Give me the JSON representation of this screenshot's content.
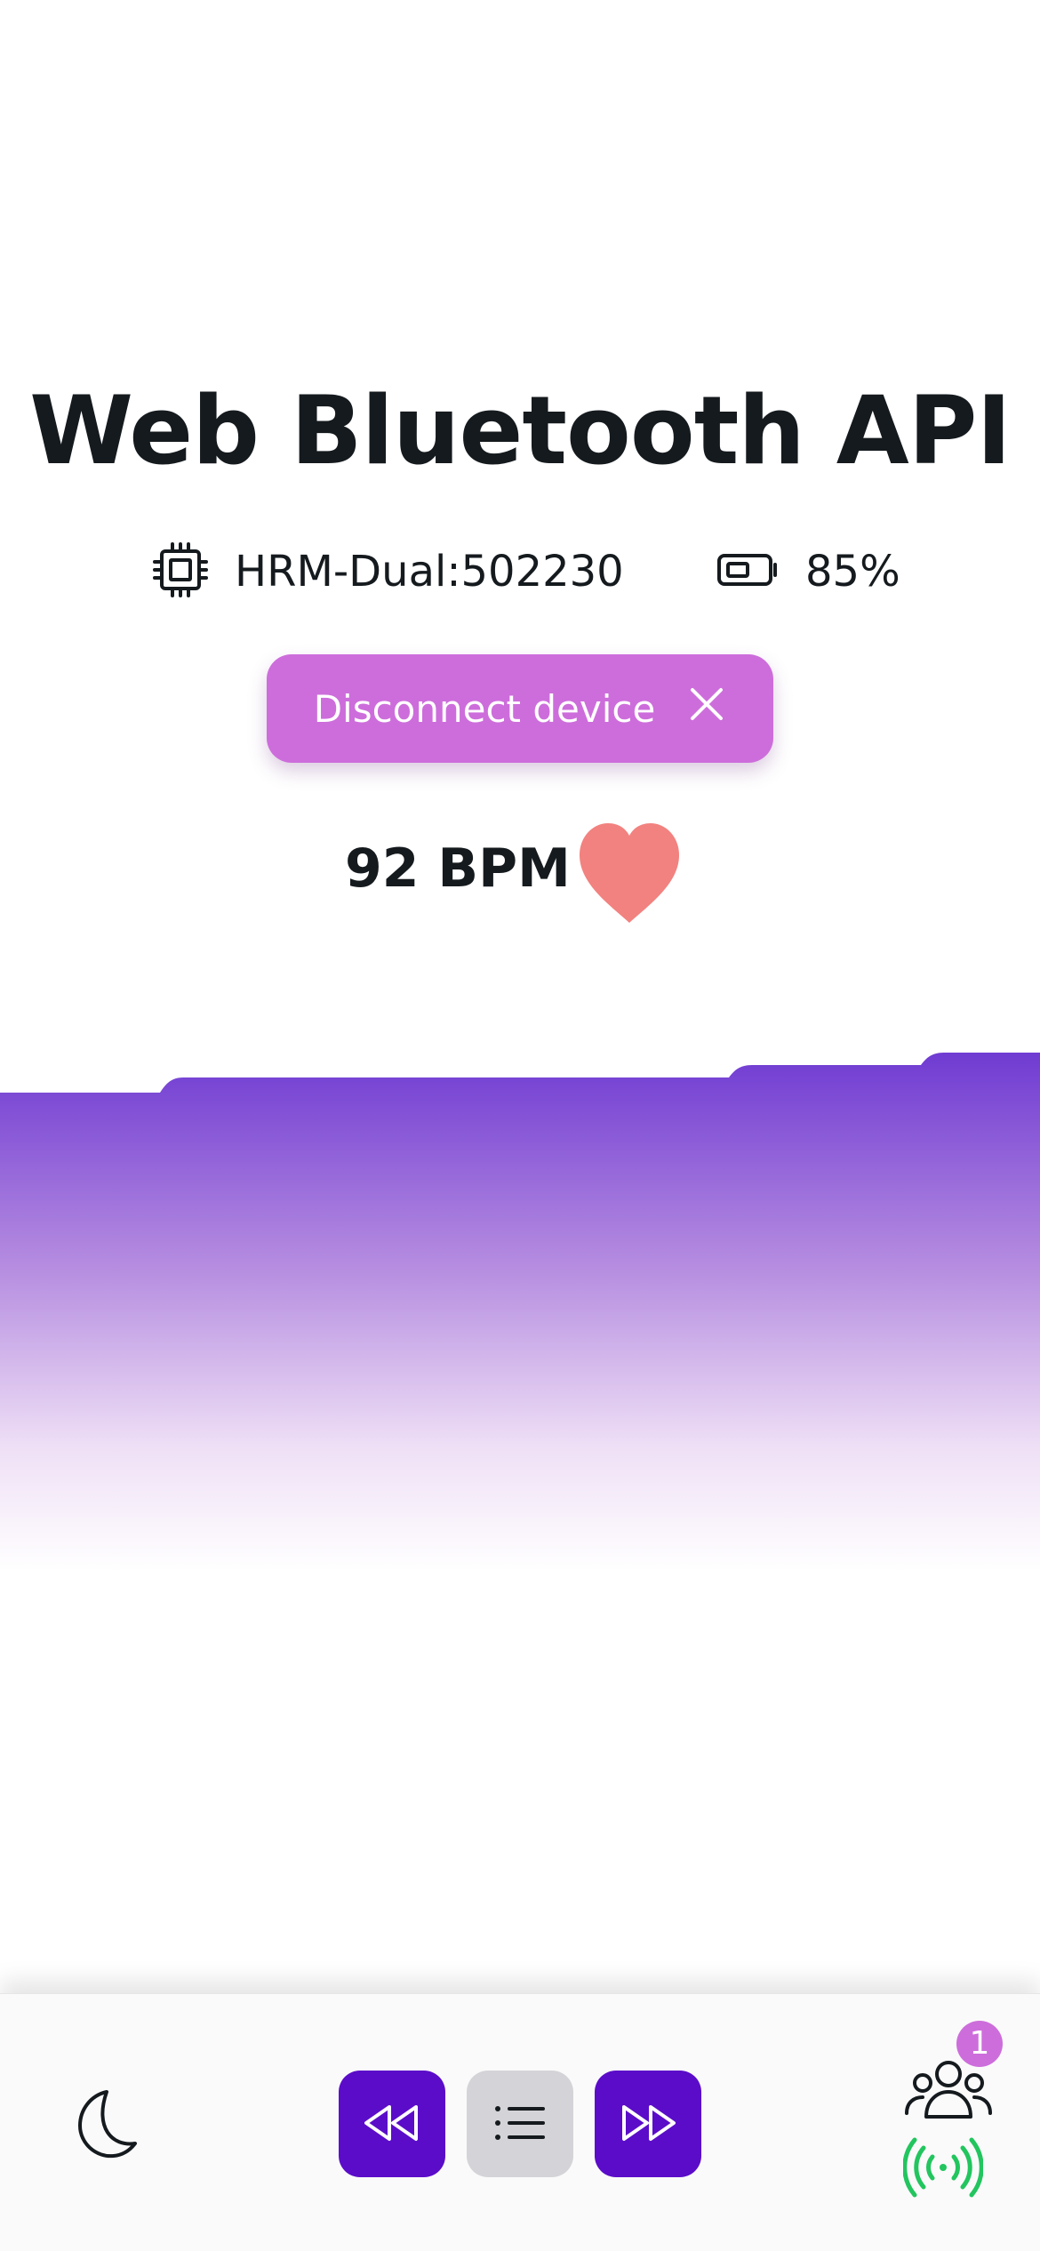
{
  "page": {
    "title": "Web Bluetooth API"
  },
  "device": {
    "icon": "chip-icon",
    "name": "HRM-Dual:502230"
  },
  "battery": {
    "icon": "battery-icon",
    "level_text": "85%",
    "level": 0.85
  },
  "disconnect": {
    "label": "Disconnect device",
    "icon": "close-icon",
    "color": "#cd6ddb"
  },
  "heart_rate": {
    "value_text": "92 BPM",
    "icon": "heart-icon",
    "color": "#f2827f"
  },
  "chart": {
    "gradient_top": "#6f3bd2",
    "gradient_bottom": "#ffffff"
  },
  "bottom_bar": {
    "theme_icon": "moon-icon",
    "prev_icon": "rewind-icon",
    "list_icon": "list-icon",
    "next_icon": "fast-forward-icon",
    "users_icon": "users-icon",
    "users_badge": "1",
    "signal_icon": "broadcast-signal-icon",
    "accent": "#5b0cc9",
    "signal_color": "#22c55e"
  }
}
